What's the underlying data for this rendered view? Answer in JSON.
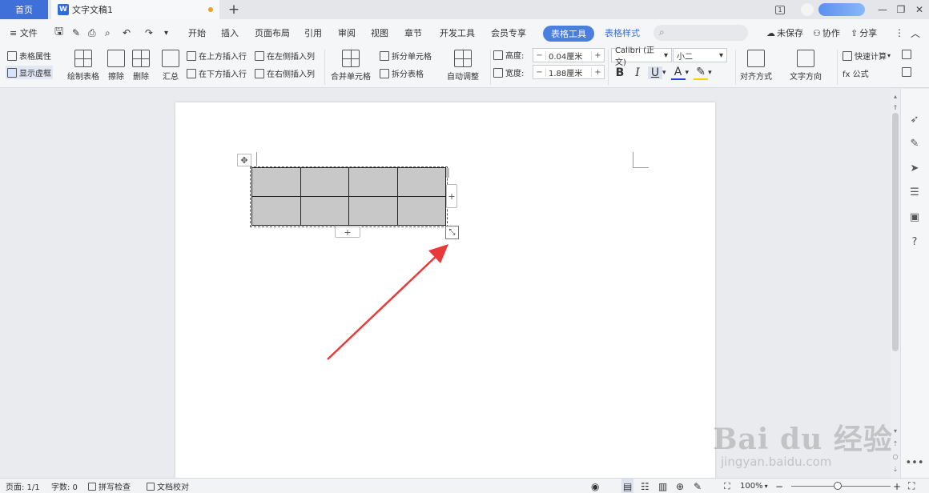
{
  "titlebar": {
    "home_tab": "首页",
    "doc_tab": "文字文稿1",
    "doc_logo": "W",
    "add_tab": "+",
    "page_count_badge": "1"
  },
  "menu": {
    "file": "≡ 文件",
    "tabs": [
      "开始",
      "插入",
      "页面布局",
      "引用",
      "审阅",
      "视图",
      "章节",
      "开发工具",
      "会员专享"
    ],
    "active_tab": "表格工具",
    "extra_tab": "表格样式",
    "unsaved": "未保存",
    "collab": "协作",
    "share": "分享"
  },
  "ribbon": {
    "table_props": "表格属性",
    "show_border": "显示虚框",
    "draw_table": "绘制表格",
    "erase": "擦除",
    "delete": "删除",
    "summary": "汇总",
    "insert_above": "在上方插入行",
    "insert_below": "在下方插入行",
    "insert_left": "在左侧插入列",
    "insert_right": "在右侧插入列",
    "merge_cells": "合并单元格",
    "split_cells": "拆分单元格",
    "split_table": "拆分表格",
    "auto_adjust": "自动调整",
    "height_label": "高度:",
    "height_value": "0.04厘米",
    "width_label": "宽度:",
    "width_value": "1.88厘米",
    "font_name": "Calibri (正文)",
    "font_size": "小二",
    "bold": "B",
    "italic": "I",
    "underline": "U",
    "font_color": "A",
    "align": "对齐方式",
    "text_dir": "文字方向",
    "quick_calc": "快速计算",
    "formula": "fx 公式"
  },
  "document": {
    "table": {
      "rows": 2,
      "cols": 4,
      "cell_fill": "#c8c8c8"
    },
    "annotation_color": "#e83a3a"
  },
  "statusbar": {
    "page": "页面: 1/1",
    "words": "字数: 0",
    "spell_check": "拼写检查",
    "doc_proof": "文档校对",
    "zoom": "100%"
  },
  "watermark": {
    "main": "Bai du 经验",
    "sub": "jingyan.baidu.com"
  },
  "colors": {
    "accent": "#3f6fd8",
    "active_tab_bg": "#4a7fe0",
    "extra_tab_text": "#3b6fd1"
  }
}
